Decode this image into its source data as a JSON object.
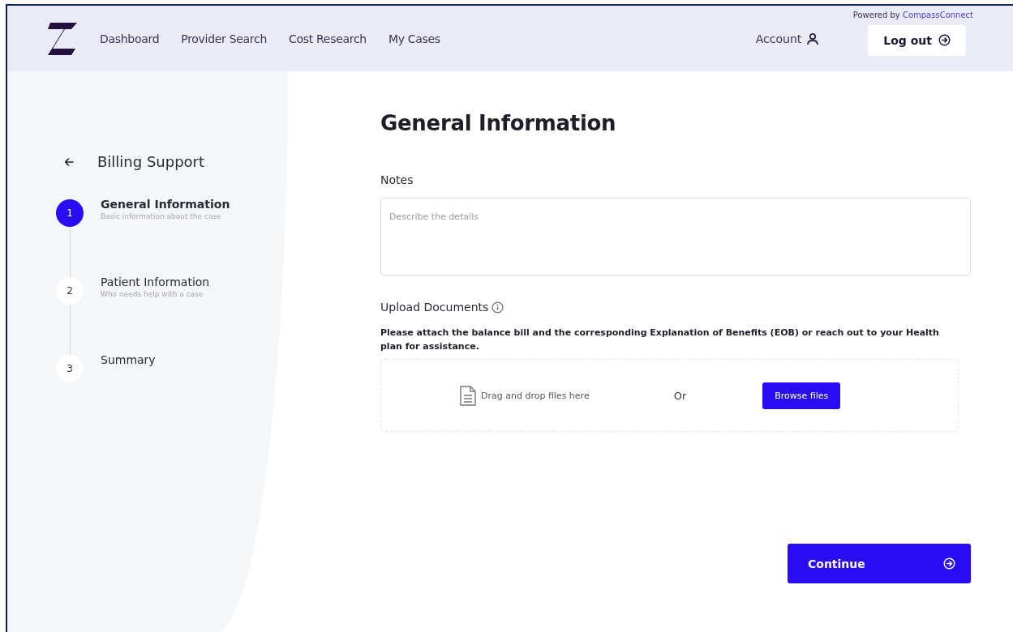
{
  "header": {
    "nav": [
      {
        "label": "Dashboard"
      },
      {
        "label": "Provider Search"
      },
      {
        "label": "Cost Research"
      },
      {
        "label": "My Cases"
      }
    ],
    "account": "Account",
    "powered_by": "Powered by",
    "powered_brand": "CompassConnect",
    "logout": "Log out"
  },
  "sidebar": {
    "title": "Billing Support",
    "steps": [
      {
        "number": "1",
        "title": "General Information",
        "subtitle": "Basic information about the case",
        "selected": true
      },
      {
        "number": "2",
        "title": "Patient Information",
        "subtitle": "Who needs help with a case",
        "selected": false
      },
      {
        "number": "3",
        "title": "Summary",
        "selected": false
      }
    ]
  },
  "form": {
    "title": "General Information",
    "notes_label": "Notes",
    "notes_placeholder": "Describe the details",
    "upload_label": "Upload Documents",
    "upload_instructions": "Please attach the balance bill and the corresponding Explanation of Benefits (EOB) or reach out to your Health plan for assistance.",
    "drop_text": "Drag and drop files here",
    "or_text": "Or",
    "browse_button": "Browse files",
    "continue_button": "Continue"
  }
}
